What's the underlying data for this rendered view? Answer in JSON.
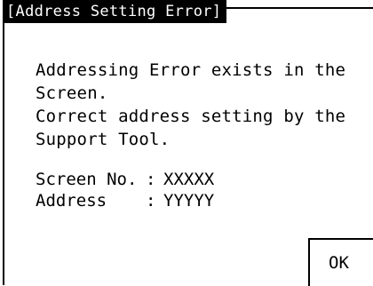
{
  "dialog": {
    "title": "Address Setting Error",
    "message_lines": [
      "Addressing Error exists in the",
      "Screen.",
      "Correct address setting by the",
      "Support Tool."
    ],
    "details": [
      {
        "label": "Screen No.",
        "separator": ":",
        "value": "XXXXX"
      },
      {
        "label": "Address",
        "separator": ":",
        "value": "YYYYY"
      }
    ],
    "ok_label": "OK"
  }
}
